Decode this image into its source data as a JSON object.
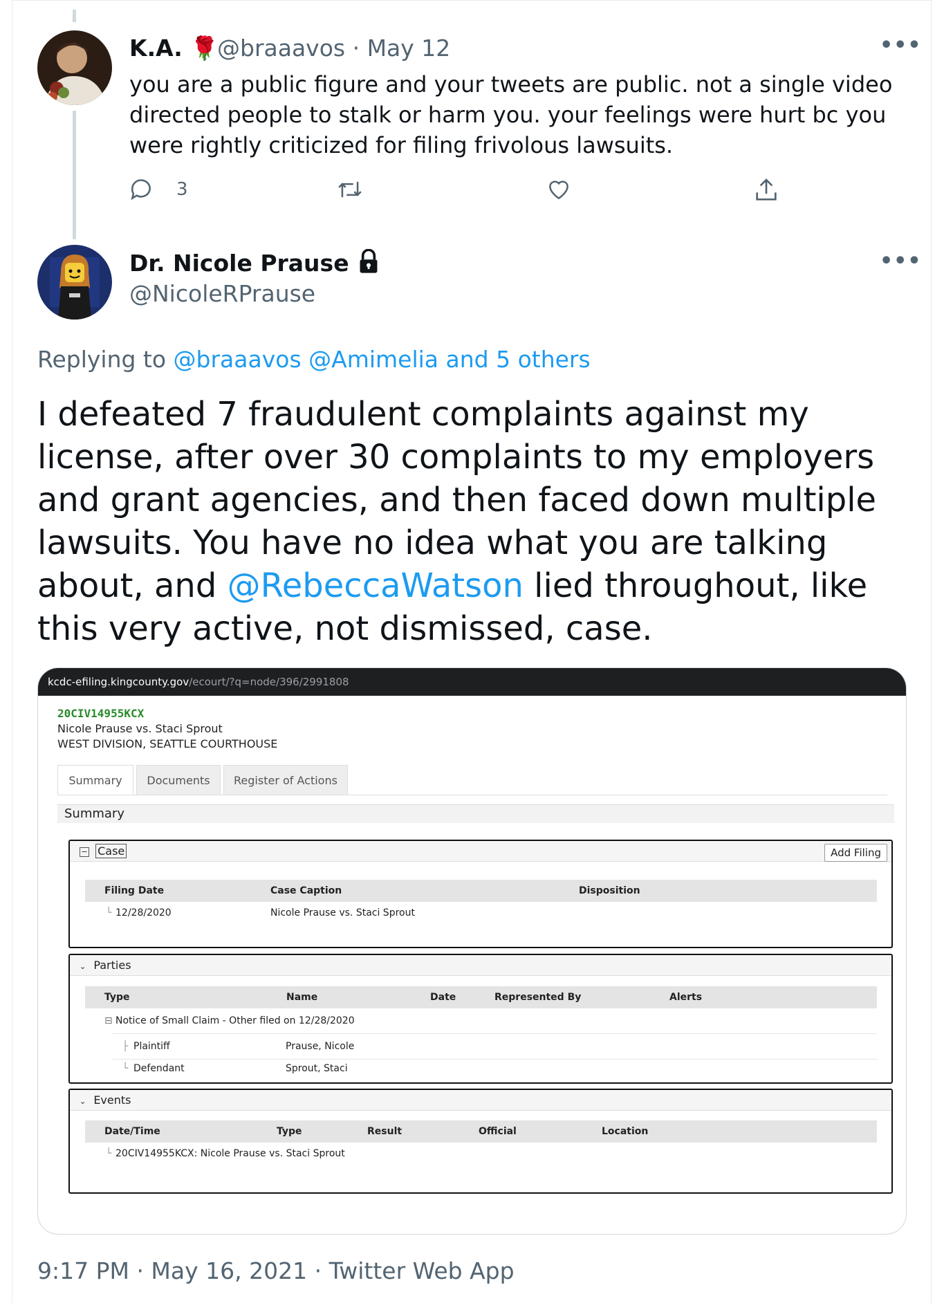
{
  "tweet1": {
    "name": "K.A.",
    "rose_emoji": "🌹",
    "handle_date": "@braaavos · May 12",
    "text": "you are a public figure and your tweets are public. not a single video directed people to stalk or harm you. your feelings were hurt bc you were rightly criticized for filing frivolous lawsuits.",
    "reply_count": "3"
  },
  "tweet2": {
    "name": "Dr. Nicole Prause",
    "handle": "@NicoleRPrause",
    "replying_prefix": "Replying to ",
    "replying_to": "@braaavos @Amimelia and 5 others",
    "text_before_mention": "I defeated 7 fraudulent complaints against my license, after over 30 complaints to my employers and grant agencies, and then faced down multiple lawsuits. You have no idea what you are talking about, and ",
    "mention": "@RebeccaWatson",
    "text_after_mention": " lied throughout, like this very active, not dismissed, case.",
    "timestamp": "9:17 PM · May 16, 2021 · Twitter Web App"
  },
  "screenshot": {
    "url_host": "kcdc-efiling.kingcounty.gov",
    "url_path": "/ecourt/?q=node/396/2991808",
    "case_id": "20CIV14955KCX",
    "case_caption": "Nicole Prause vs. Staci Sprout",
    "case_division": "WEST DIVISION, SEATTLE COURTHOUSE",
    "tabs": [
      "Summary",
      "Documents",
      "Register of Actions"
    ],
    "summary_label": "Summary",
    "case_section": {
      "title": "Case",
      "add_filing": "Add Filing",
      "headers": [
        "Filing Date",
        "Case Caption",
        "Disposition"
      ],
      "row": {
        "filing_date": "12/28/2020",
        "caption": "Nicole Prause vs. Staci Sprout"
      }
    },
    "parties_section": {
      "title": "Parties",
      "headers": [
        "Type",
        "Name",
        "Date",
        "Represented By",
        "Alerts"
      ],
      "notice": "Notice of Small Claim - Other filed on 12/28/2020",
      "rows": [
        {
          "type": "Plaintiff",
          "name": "Prause, Nicole"
        },
        {
          "type": "Defendant",
          "name": "Sprout, Staci"
        }
      ]
    },
    "events_section": {
      "title": "Events",
      "headers": [
        "Date/Time",
        "Type",
        "Result",
        "Official",
        "Location"
      ],
      "row": "20CIV14955KCX: Nicole Prause vs. Staci Sprout"
    }
  },
  "colors": {
    "link": "#1d9bf0",
    "secondary_text": "#536471",
    "case_id_green": "#2a8a2a"
  }
}
